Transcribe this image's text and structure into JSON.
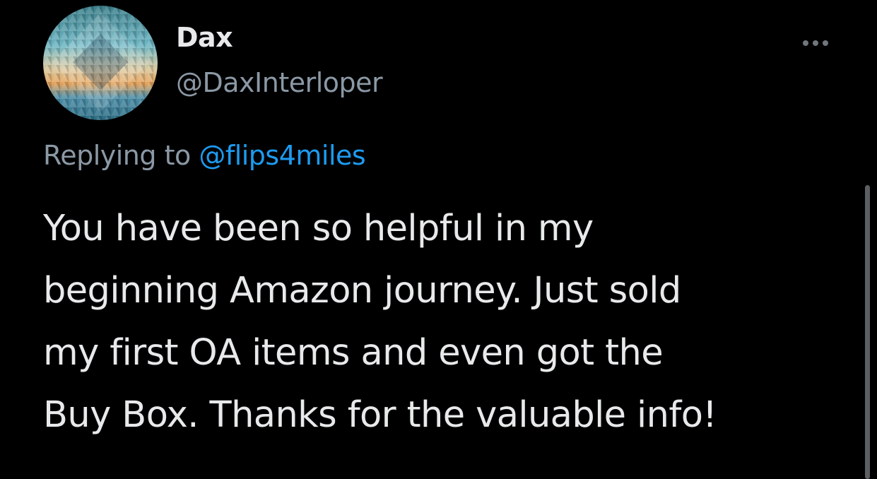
{
  "tweet": {
    "author": {
      "display_name": "Dax",
      "handle": "@DaxInterloper",
      "avatar": "geometric-pattern-avatar"
    },
    "more_icon": "more-horizontal-icon",
    "reply": {
      "prefix": "Replying to ",
      "mention": "@flips4miles"
    },
    "text_lines": [
      "You have been so helpful in my",
      "beginning Amazon journey. Just sold",
      "my first OA items and even got the",
      "Buy Box. Thanks for the valuable info!"
    ]
  },
  "colors": {
    "background": "#000000",
    "primary_text": "#e7e9ea",
    "secondary_text": "#8b98a5",
    "link": "#1d9bf0"
  }
}
